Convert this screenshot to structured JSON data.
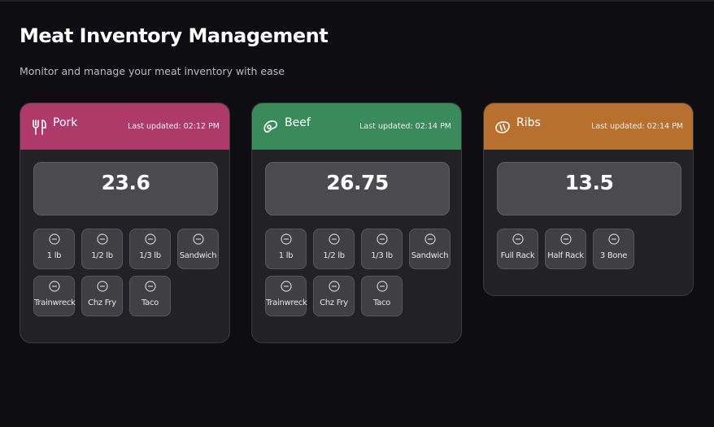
{
  "page": {
    "title": "Meat Inventory Management",
    "subtitle": "Monitor and manage your meat inventory with ease"
  },
  "cards": [
    {
      "name": "Pork",
      "icon": "utensils-icon",
      "color": "#ad3a69",
      "updated": "Last updated: 02:12 PM",
      "count": "23.6",
      "buttons": [
        "1 lb",
        "1/2 lb",
        "1/3 lb",
        "Sandwich",
        "Trainwreck",
        "Chz Fry",
        "Taco"
      ]
    },
    {
      "name": "Beef",
      "icon": "steak-icon",
      "color": "#3a8a5c",
      "updated": "Last updated: 02:14 PM",
      "count": "26.75",
      "buttons": [
        "1 lb",
        "1/2 lb",
        "1/3 lb",
        "Sandwich",
        "Trainwreck",
        "Chz Fry",
        "Taco"
      ]
    },
    {
      "name": "Ribs",
      "icon": "ribs-icon",
      "color": "#b8702f",
      "updated": "Last updated: 02:14 PM",
      "count": "13.5",
      "buttons": [
        "Full Rack",
        "Half Rack",
        "3 Bone"
      ]
    }
  ]
}
